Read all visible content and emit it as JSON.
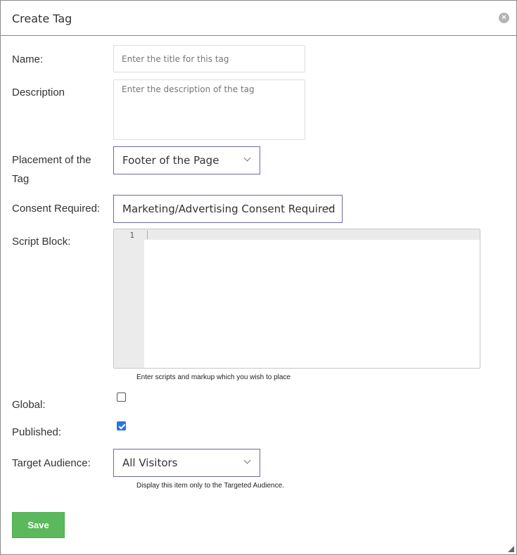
{
  "dialog": {
    "title": "Create Tag",
    "close_icon": "close-circle-icon"
  },
  "form": {
    "name_label": "Name:",
    "name_placeholder": "Enter the title for this tag",
    "description_label": "Description",
    "description_placeholder": "Enter the description of the tag",
    "placement_label_line1": "Placement of the",
    "placement_label_line2": "Tag",
    "placement_value": "Footer of the Page",
    "consent_label": "Consent Required:",
    "consent_value": "Marketing/Advertising Consent Required",
    "script_label": "Script Block:",
    "script_line_number": "1",
    "script_help": "Enter scripts and markup which you wish to place",
    "global_label": "Global:",
    "global_checked": false,
    "published_label": "Published:",
    "published_checked": true,
    "audience_label": "Target Audience:",
    "audience_value": "All Visitors",
    "audience_help": "Display this item only to the Targeted Audience."
  },
  "actions": {
    "save_label": "Save"
  },
  "colors": {
    "save_button": "#5cb85c",
    "select_border": "#6b6aa0",
    "checkbox_checked": "#2a73e8"
  }
}
